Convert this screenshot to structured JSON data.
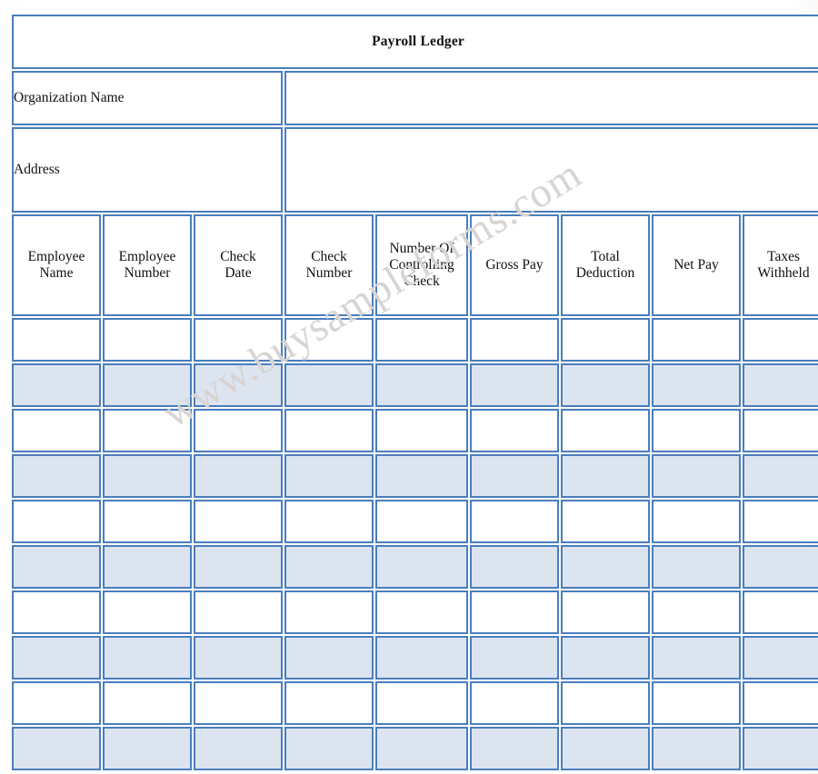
{
  "document": {
    "title": "Payroll Ledger"
  },
  "watermark": {
    "text": "www.buysampleforms.com",
    "color": "#d8d4d2"
  },
  "info_fields": [
    {
      "label": "Organization Name",
      "value": ""
    },
    {
      "label": "Address",
      "value": ""
    }
  ],
  "table": {
    "columns": [
      "Employee Name",
      "Employee Number",
      "Check Date",
      "Check Number",
      "Number Of Controlling Check",
      "Gross Pay",
      "Total Deduction",
      "Net Pay",
      "Taxes Withheld"
    ],
    "column_lines": [
      [
        "Employee",
        "Name"
      ],
      [
        "Employee",
        "Number"
      ],
      [
        "Check",
        "Date"
      ],
      [
        "Check",
        "Number"
      ],
      [
        "Number Of",
        "Controlling",
        "Check"
      ],
      [
        "Gross Pay"
      ],
      [
        "Total",
        "Deduction"
      ],
      [
        "Net Pay"
      ],
      [
        "Taxes",
        "Withheld"
      ]
    ],
    "row_count": 10,
    "rows": [
      [
        "",
        "",
        "",
        "",
        "",
        "",
        "",
        "",
        ""
      ],
      [
        "",
        "",
        "",
        "",
        "",
        "",
        "",
        "",
        ""
      ],
      [
        "",
        "",
        "",
        "",
        "",
        "",
        "",
        "",
        ""
      ],
      [
        "",
        "",
        "",
        "",
        "",
        "",
        "",
        "",
        ""
      ],
      [
        "",
        "",
        "",
        "",
        "",
        "",
        "",
        "",
        ""
      ],
      [
        "",
        "",
        "",
        "",
        "",
        "",
        "",
        "",
        ""
      ],
      [
        "",
        "",
        "",
        "",
        "",
        "",
        "",
        "",
        ""
      ],
      [
        "",
        "",
        "",
        "",
        "",
        "",
        "",
        "",
        ""
      ],
      [
        "",
        "",
        "",
        "",
        "",
        "",
        "",
        "",
        ""
      ],
      [
        "",
        "",
        "",
        "",
        "",
        "",
        "",
        "",
        ""
      ]
    ]
  },
  "colors": {
    "border": "#4a7ebb",
    "title_background": "#b9cfe7",
    "header_background": "#dce4f0",
    "row_tint": "#dce4f0",
    "row_white": "#ffffff",
    "text": "#111111"
  }
}
